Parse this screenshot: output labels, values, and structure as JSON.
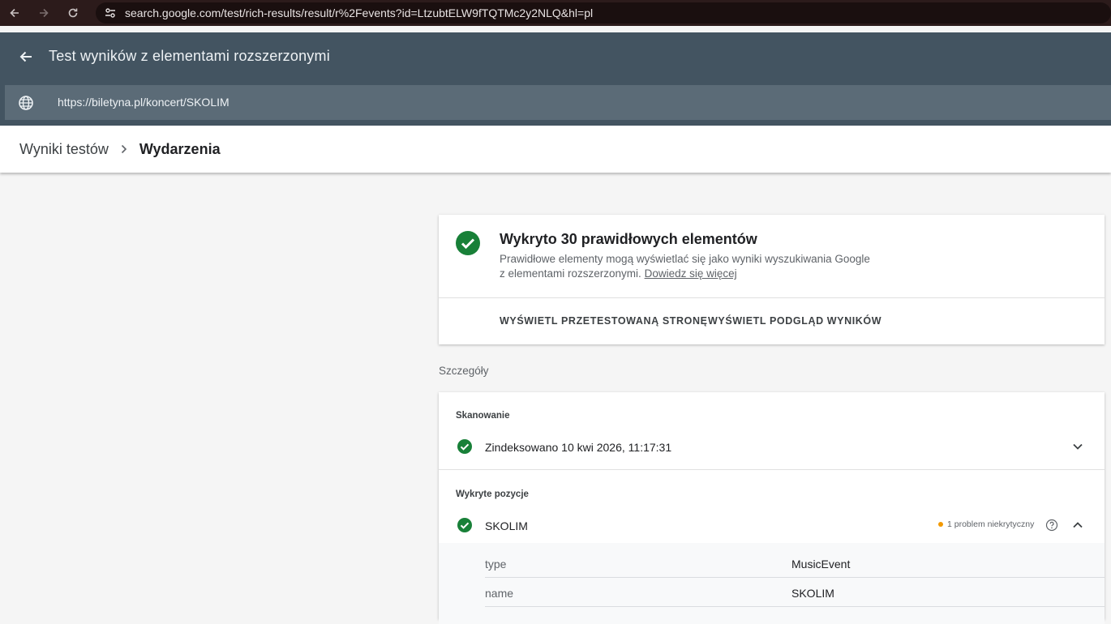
{
  "browser": {
    "url": "search.google.com/test/rich-results/result/r%2Fevents?id=LtzubtELW9fTQTMc2y2NLQ&hl=pl"
  },
  "app": {
    "title": "Test wyników z elementami rozszerzonymi",
    "tested_url": "https://biletyna.pl/koncert/SKOLIM"
  },
  "breadcrumb": {
    "root": "Wyniki testów",
    "separator": ">",
    "current": "Wydarzenia"
  },
  "summary": {
    "headline": "Wykryto 30 prawidłowych elementów",
    "description_line1": "Prawidłowe elementy mogą wyświetlać się jako wyniki wyszukiwania Google",
    "description_line2": "z elementami rozszerzonymi.",
    "learn_more": "Dowiedz się więcej",
    "view_tested_page": "WYŚWIETL PRZETESTOWANĄ STRONĘ",
    "preview_results": "WYŚWIETL PODGLĄD WYNIKÓW"
  },
  "details": {
    "label": "Szczegóły",
    "crawl": {
      "title": "Skanowanie",
      "status": "Zindeksowano 10 kwi 2026, 11:17:31"
    },
    "detected": {
      "title": "Wykryte pozycje",
      "item_name": "SKOLIM",
      "issue_text": "1 problem niekrytyczny",
      "properties": [
        {
          "name": "type",
          "value": "MusicEvent"
        },
        {
          "name": "name",
          "value": "SKOLIM"
        }
      ]
    }
  },
  "colors": {
    "success": "#188038",
    "warning": "#f29900",
    "appbar": "#435461"
  }
}
